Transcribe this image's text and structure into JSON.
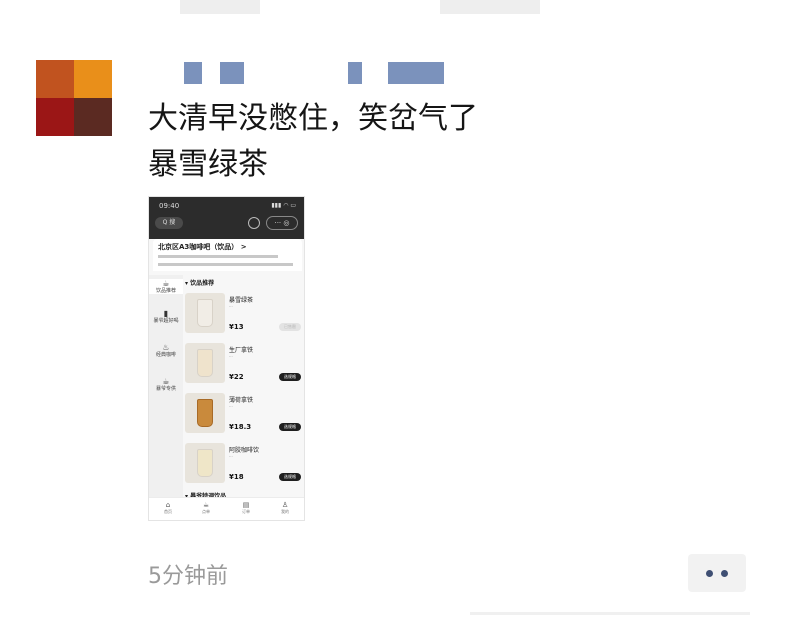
{
  "post": {
    "lines": [
      "大清早没憋住，笑岔气了",
      "暴雪绿茶"
    ],
    "timestamp": "5分钟前"
  },
  "screenshot": {
    "status_time": "09:40",
    "status_icons": "▮▮▮ ◠ ▭",
    "search_label": "Q 搜",
    "capsule_label": "··· ◎",
    "store_name": "北京区A3咖啡吧（饮品） >",
    "categories": [
      {
        "icon": "☕",
        "label": "饮品推荐"
      },
      {
        "icon": "▮",
        "label": "暴爷超好喝"
      },
      {
        "icon": "♨",
        "label": "经典咖啡"
      },
      {
        "icon": "☕",
        "label": "暴爷专供"
      }
    ],
    "section_title": "▾ 饮品推荐",
    "items": [
      {
        "name": "暴雪绿茶",
        "sub": "···",
        "price": "¥13",
        "add": "已售罄"
      },
      {
        "name": "生厂拿铁",
        "sub": "···",
        "price": "¥22",
        "add": "选规格"
      },
      {
        "name": "薄荷拿铁",
        "sub": "···",
        "price": "¥18.3",
        "add": "选规格"
      },
      {
        "name": "阿胶咖啡饮",
        "sub": "···",
        "price": "¥18",
        "add": "选规格"
      }
    ],
    "next_section": "▾ 暴爷特调饮品",
    "nav": [
      {
        "icon": "⌂",
        "label": "首页"
      },
      {
        "icon": "☕",
        "label": "点单"
      },
      {
        "icon": "▤",
        "label": "订单"
      },
      {
        "icon": "♙",
        "label": "我的"
      }
    ]
  },
  "colors": {
    "nickname_blur": "#4f6ea6",
    "timestamp": "#9a9a9a",
    "more_dots": "#3f4f73"
  }
}
